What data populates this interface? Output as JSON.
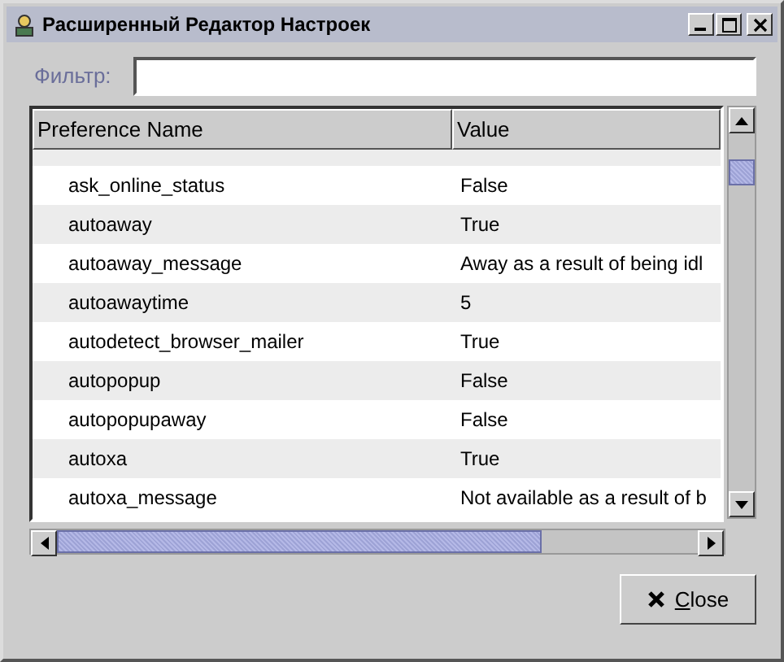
{
  "window": {
    "title": "Расширенный Редактор Настроек"
  },
  "filter": {
    "label": "Фильтр:"
  },
  "table": {
    "columns": [
      "Preference Name",
      "Value"
    ],
    "rows": [
      {
        "name": "ask_online_status",
        "value": "False"
      },
      {
        "name": "autoaway",
        "value": "True"
      },
      {
        "name": "autoaway_message",
        "value": "Away as a result of being idl"
      },
      {
        "name": "autoawaytime",
        "value": "5"
      },
      {
        "name": "autodetect_browser_mailer",
        "value": "True"
      },
      {
        "name": "autopopup",
        "value": "False"
      },
      {
        "name": "autopopupaway",
        "value": "False"
      },
      {
        "name": "autoxa",
        "value": "True"
      },
      {
        "name": "autoxa_message",
        "value": "Not available as a result of b"
      }
    ]
  },
  "buttons": [
    {
      "label": "Close",
      "kind": "close"
    }
  ]
}
